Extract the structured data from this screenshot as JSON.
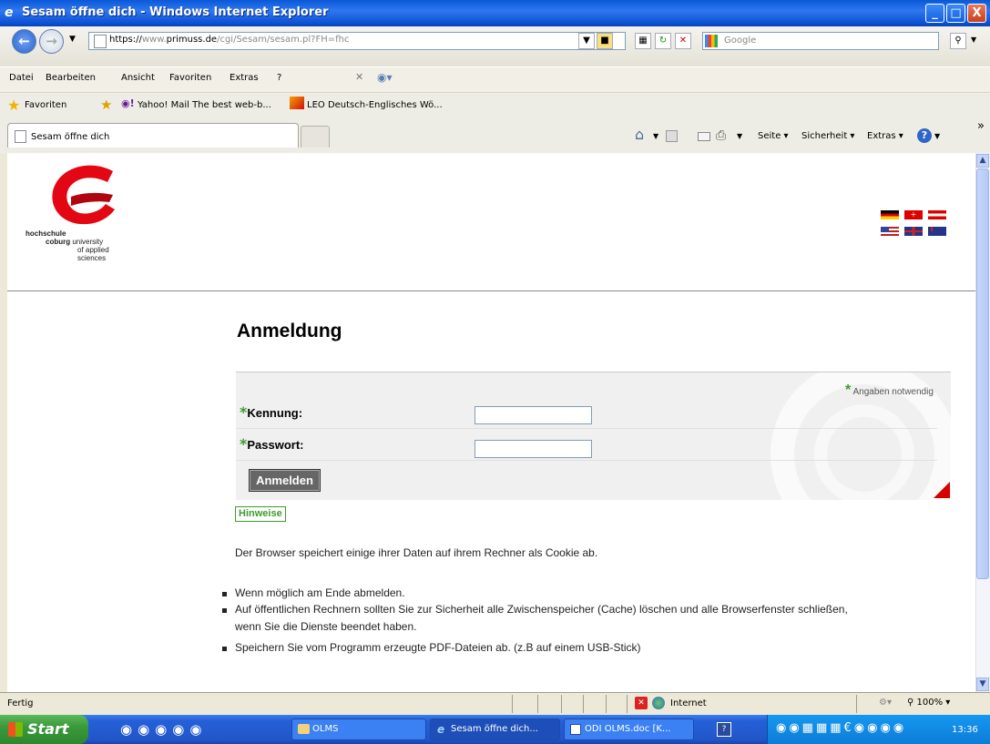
{
  "window": {
    "title": "Sesam öffne dich - Windows Internet Explorer",
    "minimize": "_",
    "maximize": "□",
    "close": "X"
  },
  "address": {
    "protocol": "https://",
    "host_prefix": "www.",
    "host_main": "primuss.de",
    "path": "/cgi/Sesam/sesam.pl?FH=fhc",
    "search_placeholder": "Google"
  },
  "menu": [
    "Datei",
    "Bearbeiten",
    "Ansicht",
    "Favoriten",
    "Extras",
    "?"
  ],
  "favorites": {
    "label": "Favoriten",
    "items": [
      "Yahoo! Mail The best web-b...",
      "LEO Deutsch-Englisches Wö..."
    ]
  },
  "tab": {
    "title": "Sesam öffne dich"
  },
  "commandbar": {
    "page": "Seite",
    "safety": "Sicherheit",
    "tools": "Extras",
    "more": "»"
  },
  "logo": {
    "line1": "hochschule",
    "line2a": "coburg",
    "line2b": "university",
    "line3": "of applied",
    "line4": "sciences"
  },
  "flags": [
    "de",
    "ch",
    "at",
    "us",
    "gb",
    "au"
  ],
  "login": {
    "heading": "Anmeldung",
    "required_note": "Angaben notwendig",
    "required_star": "*",
    "username_label": "Kennung:",
    "password_label": "Passwort:",
    "submit": "Anmelden",
    "hints": "Hinweise"
  },
  "info": {
    "cookie_text": "Der Browser speichert einige ihrer Daten auf ihrem Rechner als Cookie ab.",
    "bullets": [
      "Wenn möglich am Ende abmelden.",
      "Auf öffentlichen Rechnern sollten Sie zur Sicherheit alle Zwischenspeicher (Cache) löschen und alle Browserfenster schließen,",
      "Speichern Sie vom Programm erzeugte PDF-Dateien ab. (z.B auf einem USB-Stick)"
    ],
    "bullet2_continued": "wenn Sie die Dienste beendet haben."
  },
  "status": {
    "left": "Fertig",
    "zone": "Internet",
    "zoom": "100%"
  },
  "taskbar": {
    "start": "Start",
    "items": [
      "OLMS",
      "Sesam öffne dich...",
      "ODI OLMS.doc [K..."
    ],
    "clock": "13:36"
  },
  "colors": {
    "required_green": "#3f9a2f",
    "logo_red": "#e30613",
    "xp_blue": "#0a58d8"
  }
}
